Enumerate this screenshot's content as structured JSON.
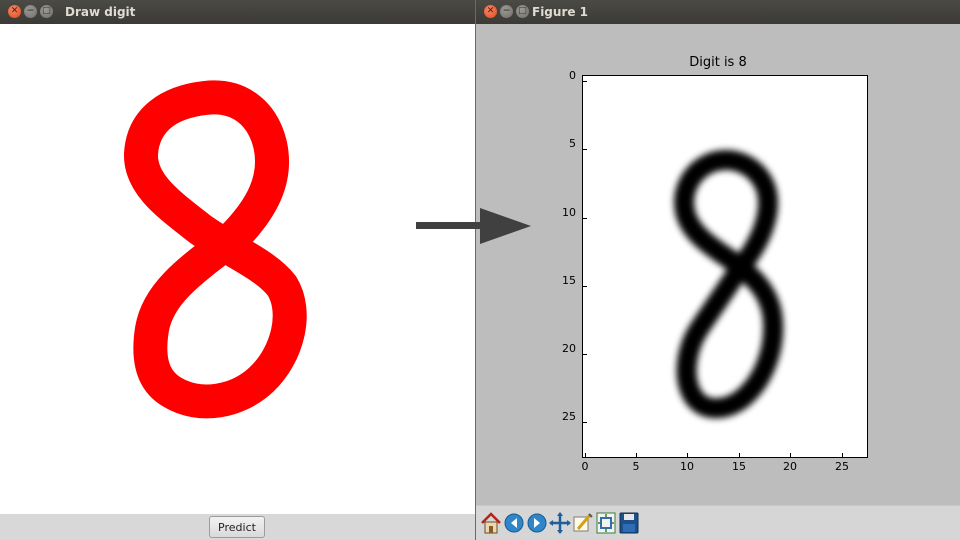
{
  "draw_window": {
    "title": "Draw digit",
    "predict_label": "Predict",
    "stroke_color": "#ff0000"
  },
  "figure_window": {
    "title": "Figure 1",
    "plot_title": "Digit is 8",
    "y_ticks": [
      "0",
      "5",
      "10",
      "15",
      "20",
      "25"
    ],
    "x_ticks": [
      "0",
      "5",
      "10",
      "15",
      "20",
      "25"
    ],
    "image_colormap": "gray_r",
    "predicted_digit": 8,
    "toolbar_icons": [
      "home-icon",
      "back-icon",
      "forward-icon",
      "pan-icon",
      "zoom-icon",
      "configure-subplots-icon",
      "save-icon"
    ]
  },
  "arrow_color": "#404040"
}
